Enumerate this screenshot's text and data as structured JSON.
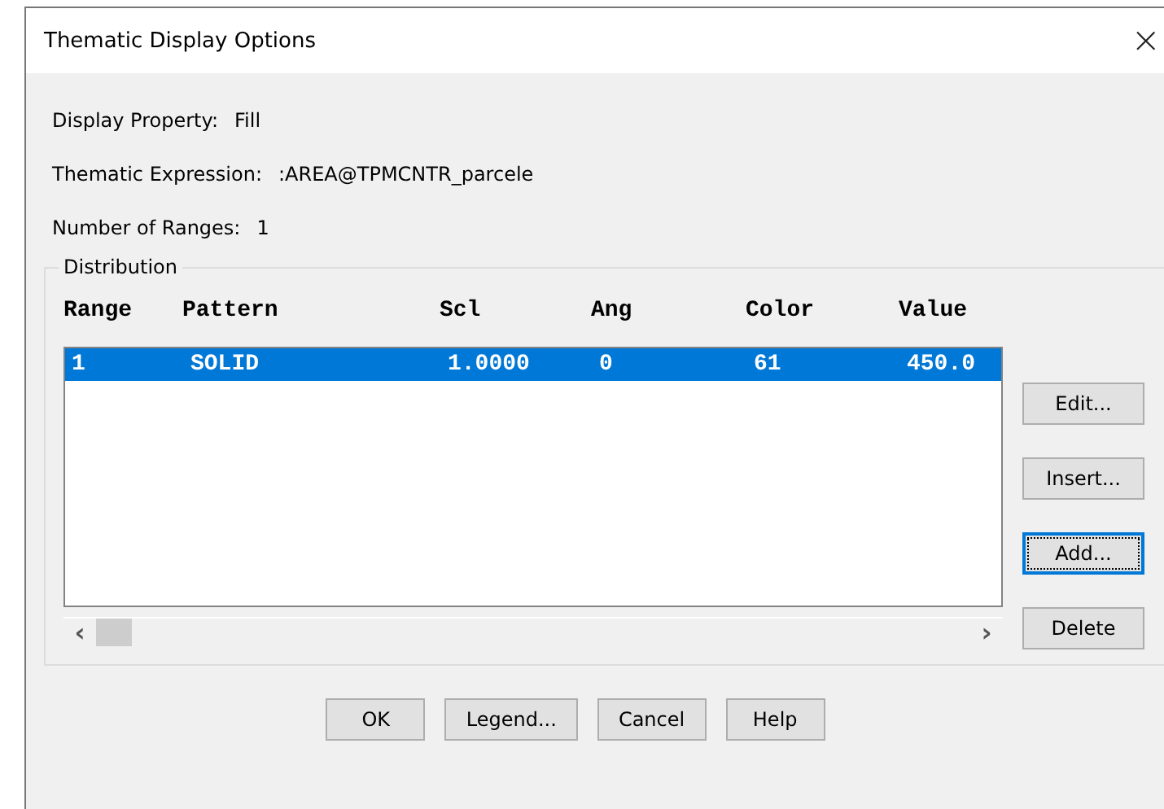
{
  "window": {
    "title": "Thematic Display Options",
    "close": "×"
  },
  "info": [
    {
      "label": "Display Property:",
      "value": "Fill"
    },
    {
      "label": "Thematic  Expression:",
      "value": ":AREA@TPMCNTR_parcele"
    },
    {
      "label": "Number of Ranges:",
      "value": "1"
    }
  ],
  "distribution": {
    "title": "Distribution",
    "columns": [
      "Range",
      "Pattern",
      "Scl",
      "Ang",
      "Color",
      "Value"
    ],
    "rows": [
      {
        "selected": true,
        "cells": [
          "1",
          "SOLID",
          "1.0000",
          "0",
          "61",
          "450.0"
        ]
      }
    ],
    "scroll_left": "‹",
    "scroll_right": "›",
    "buttons": [
      {
        "label": "Edit...",
        "focused": false
      },
      {
        "label": "Insert...",
        "focused": false
      },
      {
        "label": "Add...",
        "focused": true
      },
      {
        "label": "Delete",
        "focused": false
      }
    ]
  },
  "buttons": [
    {
      "label": "OK"
    },
    {
      "label": "Legend..."
    },
    {
      "label": "Cancel"
    },
    {
      "label": "Help"
    }
  ]
}
